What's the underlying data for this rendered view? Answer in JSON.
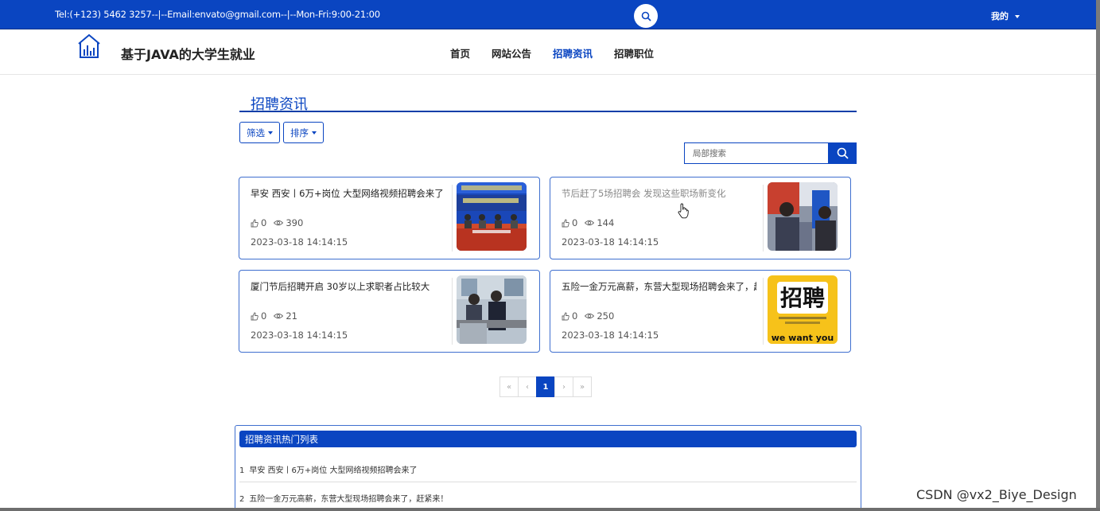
{
  "topbar": {
    "contact": "Tel:(+123) 5462 3257--|--Email:envato@gmail.com--|--Mon-Fri:9:00-21:00",
    "search_icon": "search-icon",
    "user_menu": "我的"
  },
  "header": {
    "logo_icon": "building-chart-icon",
    "site_title": "基于JAVA的大学生就业",
    "nav": [
      {
        "label": "首页",
        "active": false
      },
      {
        "label": "网站公告",
        "active": false
      },
      {
        "label": "招聘资讯",
        "active": true
      },
      {
        "label": "招聘职位",
        "active": false
      }
    ]
  },
  "main": {
    "section_title": "招聘资讯",
    "filter_label": "筛选",
    "sort_label": "排序",
    "search_placeholder": "局部搜索",
    "cards": [
      {
        "title": "早安 西安丨6万+岗位 大型网络视频招聘会来了",
        "likes": "0",
        "views": "390",
        "date": "2023-03-18 14:14:15",
        "thumb": "conference-panel-photo"
      },
      {
        "title": "节后赶了5场招聘会 发现这些职场新变化",
        "likes": "0",
        "views": "144",
        "date": "2023-03-18 14:14:15",
        "thumb": "job-fair-photo"
      },
      {
        "title": "厦门节后招聘开启 30岁以上求职者占比较大",
        "likes": "0",
        "views": "21",
        "date": "2023-03-18 14:14:15",
        "thumb": "interview-desk-photo"
      },
      {
        "title": "五险一金万元高薪，东营大型现场招聘会来了，赶紧来！",
        "likes": "0",
        "views": "250",
        "date": "2023-03-18 14:14:15",
        "thumb": "hiring-poster",
        "poster_big": "招聘",
        "poster_small": "we want you"
      }
    ],
    "pagination": {
      "first": "«",
      "prev": "‹",
      "current": "1",
      "next": "›",
      "last": "»"
    }
  },
  "hot_list": {
    "title": "招聘资讯热门列表",
    "items": [
      {
        "num": "1",
        "text": "早安 西安丨6万+岗位 大型网络视频招聘会来了"
      },
      {
        "num": "2",
        "text": "五险一金万元高薪，东营大型现场招聘会来了，赶紧来！"
      }
    ]
  },
  "watermark": "CSDN @vx2_Biye_Design",
  "colors": {
    "brand": "#0a45c1",
    "border": "#3f6fcf"
  }
}
